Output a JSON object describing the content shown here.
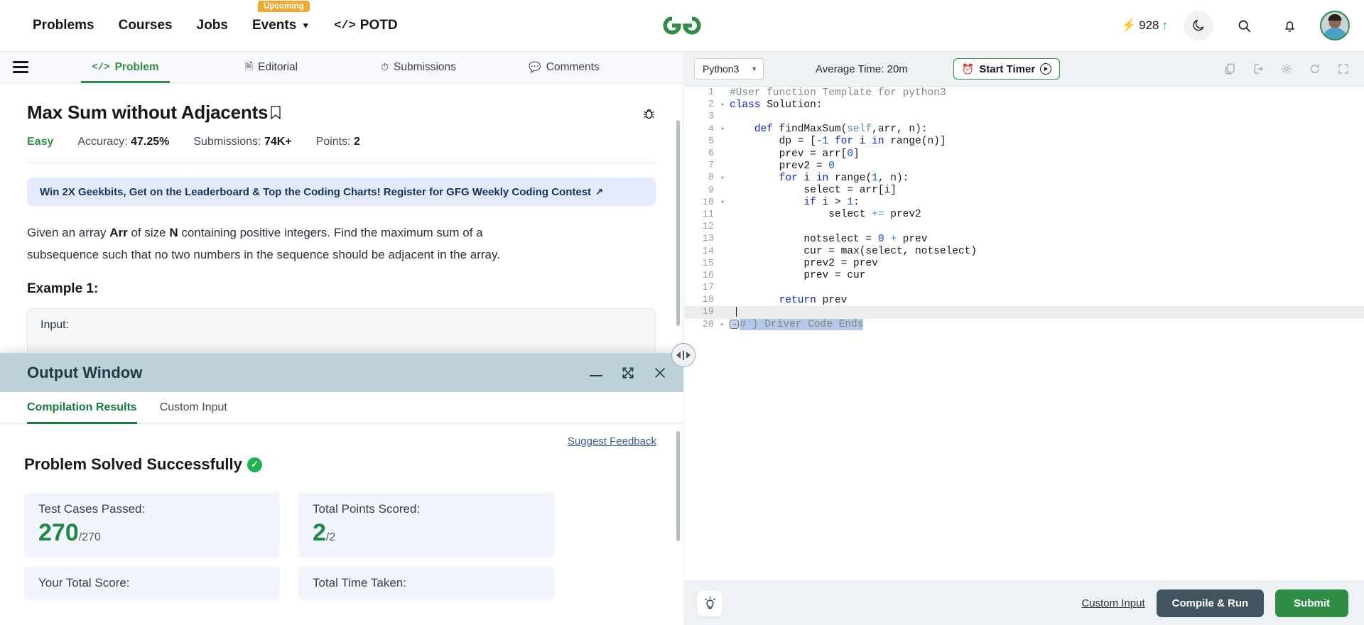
{
  "nav": {
    "items": [
      {
        "label": "Problems",
        "icon": "",
        "badge": ""
      },
      {
        "label": "Courses",
        "icon": "",
        "badge": ""
      },
      {
        "label": "Jobs",
        "icon": "",
        "badge": ""
      },
      {
        "label": "Events",
        "icon": "chevron-down-icon",
        "badge": "Upcoming"
      },
      {
        "label": "POTD",
        "icon": "code-icon",
        "badge": ""
      }
    ],
    "logo_alt": "geeksforgeeks-logo",
    "streak_count": "928",
    "streak_icon": "lightning-bolt-icon",
    "streak_arrow": "arrow-up-icon",
    "theme_icon": "moon-icon",
    "search_icon": "search-icon",
    "notification_icon": "bell-icon",
    "avatar_alt": "user-avatar"
  },
  "tabs": [
    {
      "label": "Problem",
      "icon": "code-icon",
      "active": true
    },
    {
      "label": "Editorial",
      "icon": "document-icon",
      "active": false
    },
    {
      "label": "Submissions",
      "icon": "clock-icon",
      "active": false
    },
    {
      "label": "Comments",
      "icon": "comment-icon",
      "active": false
    }
  ],
  "problem": {
    "title": "Max Sum without Adjacents",
    "bookmark_icon": "bookmark-icon",
    "report_icon": "bug-icon",
    "difficulty": "Easy",
    "accuracy_label": "Accuracy:",
    "accuracy_value": "47.25%",
    "submissions_label": "Submissions:",
    "submissions_value": "74K+",
    "points_label": "Points:",
    "points_value": "2",
    "promo_text": "Win 2X Geekbits, Get on the Leaderboard & Top the Coding Charts! Register for GFG Weekly Coding Contest",
    "promo_icon": "external-link-icon",
    "description_part1": "Given an array ",
    "description_bold1": "Arr",
    "description_part2": " of size ",
    "description_bold2": "N",
    "description_part3": " containing positive integers. Find the maximum sum of a subsequence such that no two numbers in the sequence should be adjacent in the array.",
    "example_heading": "Example 1:",
    "example_input_label": "Input:"
  },
  "output_window": {
    "title": "Output Window",
    "minimize_icon": "minimize-icon",
    "expand_icon": "expand-icon",
    "close_icon": "close-icon",
    "tabs": [
      {
        "label": "Compilation Results",
        "active": true
      },
      {
        "label": "Custom Input",
        "active": false
      }
    ],
    "suggest_feedback": "Suggest Feedback",
    "result_title": "Problem Solved Successfully",
    "result_icon": "check-circle-icon",
    "stats": [
      {
        "label": "Test Cases Passed:",
        "value": "270",
        "denom": "/270"
      },
      {
        "label": "Total Points Scored:",
        "value": "2",
        "denom": "/2"
      },
      {
        "label": "Your Total Score:",
        "value": "",
        "denom": ""
      },
      {
        "label": "Total Time Taken:",
        "value": "",
        "denom": ""
      }
    ]
  },
  "splitter": {
    "icon": "resize-horizontal-icon"
  },
  "editor": {
    "language": "Python3",
    "language_caret": "chevron-down-icon",
    "average_time": "Average Time: 20m",
    "timer_button": "Start Timer",
    "timer_icon": "alarm-clock-icon",
    "timer_play_icon": "play-icon",
    "tool_icons": [
      "copy-icon",
      "import-icon",
      "settings-gear-icon",
      "reset-refresh-icon",
      "fullscreen-icon"
    ],
    "code_lines": [
      {
        "n": "1",
        "fold": "",
        "html": "<span class=\"cm\">#User function Template for python3</span>"
      },
      {
        "n": "2",
        "fold": "▾",
        "html": "<span class=\"k\">class</span> Solution:"
      },
      {
        "n": "3",
        "fold": "",
        "html": ""
      },
      {
        "n": "4",
        "fold": "▾",
        "html": "    <span class=\"k\">def</span> findMaxSum(<span class=\"sf\">self</span>,arr, n):"
      },
      {
        "n": "5",
        "fold": "",
        "html": "        dp = [<span class=\"nm\">-1</span> <span class=\"k\">for</span> i <span class=\"k\">in</span> range(n)]"
      },
      {
        "n": "6",
        "fold": "",
        "html": "        prev = arr[<span class=\"nm\">0</span>]"
      },
      {
        "n": "7",
        "fold": "",
        "html": "        prev2 = <span class=\"nm\">0</span>"
      },
      {
        "n": "8",
        "fold": "▾",
        "html": "        <span class=\"k\">for</span> i <span class=\"k\">in</span> range(<span class=\"nm\">1</span>, n):"
      },
      {
        "n": "9",
        "fold": "",
        "html": "            select = arr[i]"
      },
      {
        "n": "10",
        "fold": "▾",
        "html": "            <span class=\"k\">if</span> i &gt; <span class=\"nm\">1</span>:"
      },
      {
        "n": "11",
        "fold": "",
        "html": "                select <span class=\"op\">+=</span> prev2"
      },
      {
        "n": "12",
        "fold": "",
        "html": ""
      },
      {
        "n": "13",
        "fold": "",
        "html": "            notselect = <span class=\"nm\">0</span> <span class=\"op\">+</span> prev"
      },
      {
        "n": "14",
        "fold": "",
        "html": "            cur = max(select, notselect)"
      },
      {
        "n": "15",
        "fold": "",
        "html": "            prev2 = prev"
      },
      {
        "n": "16",
        "fold": "",
        "html": "            prev = cur"
      },
      {
        "n": "17",
        "fold": "",
        "html": ""
      },
      {
        "n": "18",
        "fold": "",
        "html": "        <span class=\"k\">return</span> prev"
      },
      {
        "n": "19",
        "fold": "",
        "html": "",
        "active": true
      },
      {
        "n": "20",
        "fold": "▸",
        "html": "<span class=\"fold-widget\">&#8596;</span><span class=\"sel cm\"># } Driver Code Ends</span>"
      }
    ],
    "hint_icon": "lightbulb-icon",
    "custom_input_link": "Custom Input",
    "compile_run_button": "Compile & Run",
    "submit_button": "Submit"
  },
  "colors": {
    "brand_green": "#2f8d46",
    "accent_orange": "#f0a830",
    "promo_bg": "#e3eafc",
    "output_header_bg": "#bdd2d9",
    "dark_button": "#41545f"
  }
}
